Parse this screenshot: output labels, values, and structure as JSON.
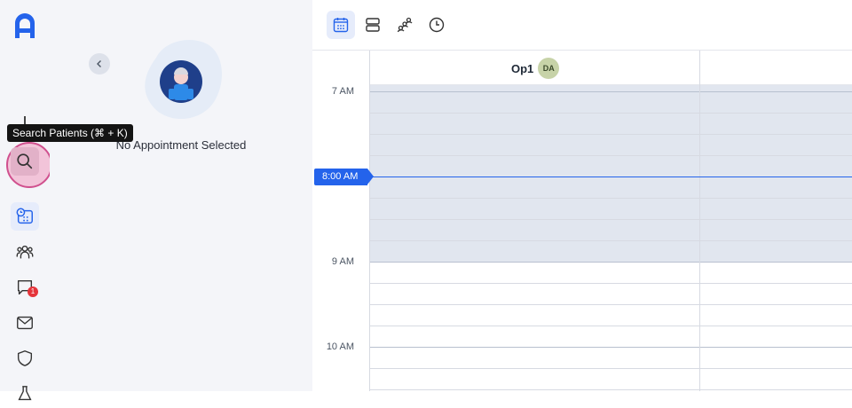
{
  "tooltip": {
    "search": "Search Patients (⌘ + K)"
  },
  "nav": {
    "items": [
      {
        "icon": "calendar-clock-icon",
        "active": true
      },
      {
        "icon": "people-icon"
      },
      {
        "icon": "chat-icon",
        "badge": "1"
      },
      {
        "icon": "mail-icon"
      },
      {
        "icon": "shield-icon"
      }
    ]
  },
  "panel": {
    "empty_text": "No Appointment Selected"
  },
  "toolbar": {
    "views": [
      {
        "icon": "calendar-grid-icon",
        "active": true
      },
      {
        "icon": "rows-icon"
      },
      {
        "icon": "group-icon"
      },
      {
        "icon": "clock-icon"
      }
    ]
  },
  "calendar": {
    "operatory": {
      "name": "Op1",
      "initials": "DA"
    },
    "times": [
      "7 AM",
      "9 AM",
      "10 AM"
    ],
    "now": "8:00 AM"
  },
  "colors": {
    "brand": "#2463eb",
    "shaded": "#e1e6ef",
    "badge": "#e5343b",
    "avatar": "#c7d3a8"
  }
}
